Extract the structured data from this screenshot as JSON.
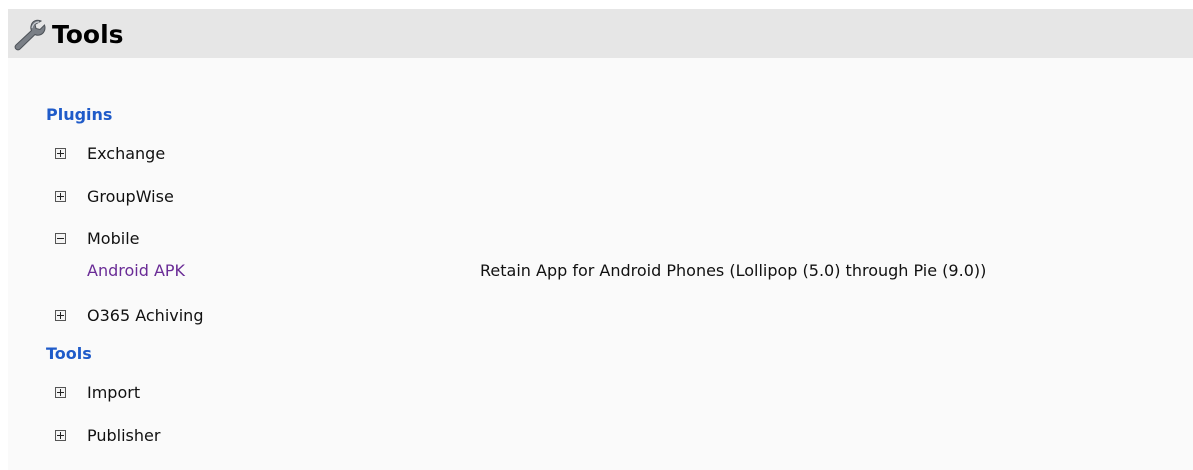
{
  "header": {
    "title": "Tools",
    "icon": "wrench-icon"
  },
  "sections": {
    "plugins": {
      "label": "Plugins",
      "items": [
        {
          "label": "Exchange",
          "state": "collapsed"
        },
        {
          "label": "GroupWise",
          "state": "collapsed"
        },
        {
          "label": "Mobile",
          "state": "expanded",
          "children": [
            {
              "link": "Android APK",
              "description": "Retain App for Android Phones (Lollipop (5.0) through Pie (9.0))"
            }
          ]
        },
        {
          "label": "O365 Achiving",
          "state": "collapsed"
        }
      ]
    },
    "tools": {
      "label": "Tools",
      "items": [
        {
          "label": "Import",
          "state": "collapsed"
        },
        {
          "label": "Publisher",
          "state": "collapsed"
        }
      ]
    }
  },
  "colors": {
    "section_heading": "#1f5bc9",
    "link": "#6a2c96",
    "header_bg": "#e6e6e6"
  }
}
